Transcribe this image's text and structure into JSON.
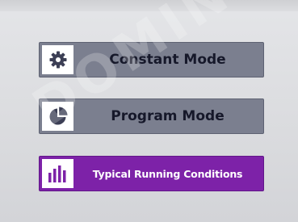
{
  "menu": {
    "buttons": [
      {
        "label": "Constant Mode",
        "icon": "gear-icon"
      },
      {
        "label": "Program Mode",
        "icon": "pie-chart-icon"
      },
      {
        "label": "Typical Running Conditions",
        "icon": "bar-chart-icon"
      }
    ]
  },
  "watermark": {
    "text": "DOMIN"
  },
  "colors": {
    "button_gray": "#7b7f8f",
    "button_purple": "#7d22a8",
    "icon_dark": "#3c3f55",
    "icon_purple": "#7d22a8",
    "background": "#dcdde0"
  }
}
